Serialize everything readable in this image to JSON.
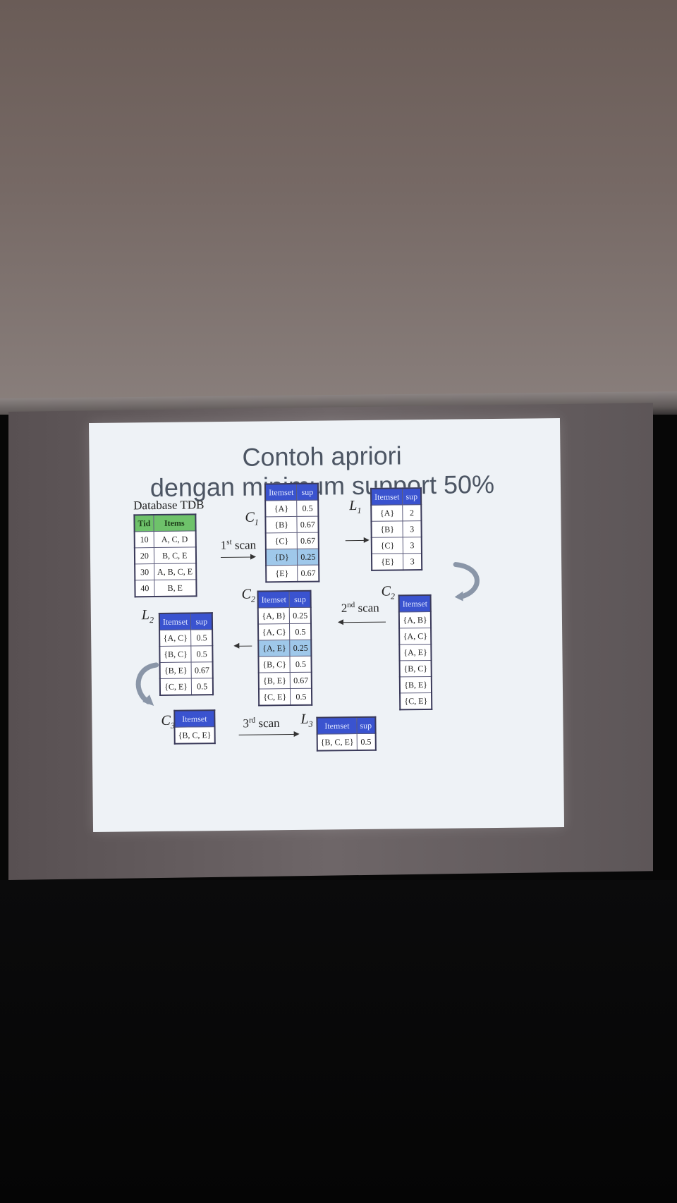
{
  "slide": {
    "title_line1": "Contoh apriori",
    "title_line2": "dengan minimum support 50%"
  },
  "tdb": {
    "caption": "Database TDB",
    "headers": [
      "Tid",
      "Items"
    ],
    "rows": [
      [
        "10",
        "A, C, D"
      ],
      [
        "20",
        "B, C, E"
      ],
      [
        "30",
        "A, B, C, E"
      ],
      [
        "40",
        "B, E"
      ]
    ]
  },
  "c1": {
    "label": "C",
    "sub": "1",
    "headers": [
      "Itemset",
      "sup"
    ],
    "rows": [
      [
        "{A}",
        "0.5"
      ],
      [
        "{B}",
        "0.67"
      ],
      [
        "{C}",
        "0.67"
      ],
      [
        "{D}",
        "0.25"
      ],
      [
        "{E}",
        "0.67"
      ]
    ]
  },
  "l1": {
    "label": "L",
    "sub": "1",
    "headers": [
      "Itemset",
      "sup"
    ],
    "rows": [
      [
        "{A}",
        "2"
      ],
      [
        "{B}",
        "3"
      ],
      [
        "{C}",
        "3"
      ],
      [
        "{E}",
        "3"
      ]
    ]
  },
  "c2a": {
    "label": "C",
    "sub": "2",
    "headers": [
      "Itemset"
    ],
    "rows": [
      [
        "{A, B}"
      ],
      [
        "{A, C}"
      ],
      [
        "{A, E}"
      ],
      [
        "{B, C}"
      ],
      [
        "{B, E}"
      ],
      [
        "{C, E}"
      ]
    ]
  },
  "c2b": {
    "label": "C",
    "sub": "2",
    "headers": [
      "Itemset",
      "sup"
    ],
    "rows": [
      [
        "{A, B}",
        "0.25"
      ],
      [
        "{A, C}",
        "0.5"
      ],
      [
        "{A, E}",
        "0.25"
      ],
      [
        "{B, C}",
        "0.5"
      ],
      [
        "{B, E}",
        "0.67"
      ],
      [
        "{C, E}",
        "0.5"
      ]
    ]
  },
  "l2": {
    "label": "L",
    "sub": "2",
    "headers": [
      "Itemset",
      "sup"
    ],
    "rows": [
      [
        "{A, C}",
        "0.5"
      ],
      [
        "{B, C}",
        "0.5"
      ],
      [
        "{B, E}",
        "0.67"
      ],
      [
        "{C, E}",
        "0.5"
      ]
    ]
  },
  "c3": {
    "label": "C",
    "sub": "3",
    "headers": [
      "Itemset"
    ],
    "rows": [
      [
        "{B, C, E}"
      ]
    ]
  },
  "l3": {
    "label": "L",
    "sub": "3",
    "headers": [
      "Itemset",
      "sup"
    ],
    "rows": [
      [
        "{B, C, E}",
        "0.5"
      ]
    ]
  },
  "scans": {
    "first": "1",
    "first_sup": "st",
    "second": "2",
    "second_sup": "nd",
    "third": "3",
    "third_sup": "rd",
    "word": "scan"
  }
}
